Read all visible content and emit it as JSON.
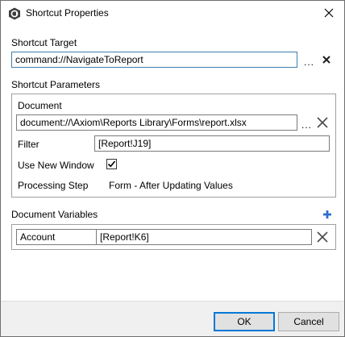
{
  "window": {
    "title": "Shortcut Properties"
  },
  "shortcut_target": {
    "label": "Shortcut Target",
    "value": "command://NavigateToReport",
    "browse_label": "..."
  },
  "shortcut_parameters": {
    "label": "Shortcut Parameters",
    "document_label": "Document",
    "document_value": "document://\\Axiom\\Reports Library\\Forms\\report.xlsx",
    "document_browse_label": "...",
    "filter_label": "Filter",
    "filter_value": "[Report!J19]",
    "use_new_window_label": "Use New Window",
    "use_new_window_checked": true,
    "processing_step_label": "Processing Step",
    "processing_step_value": "Form - After Updating Values"
  },
  "document_variables": {
    "label": "Document Variables",
    "rows": [
      {
        "name": "Account",
        "value": "[Report!K6]"
      }
    ]
  },
  "footer": {
    "ok_label": "OK",
    "cancel_label": "Cancel"
  },
  "colors": {
    "delete_x": "#1f1f1f",
    "add_icon": "#2f6fd0",
    "app_icon": "#3d3d3d"
  }
}
